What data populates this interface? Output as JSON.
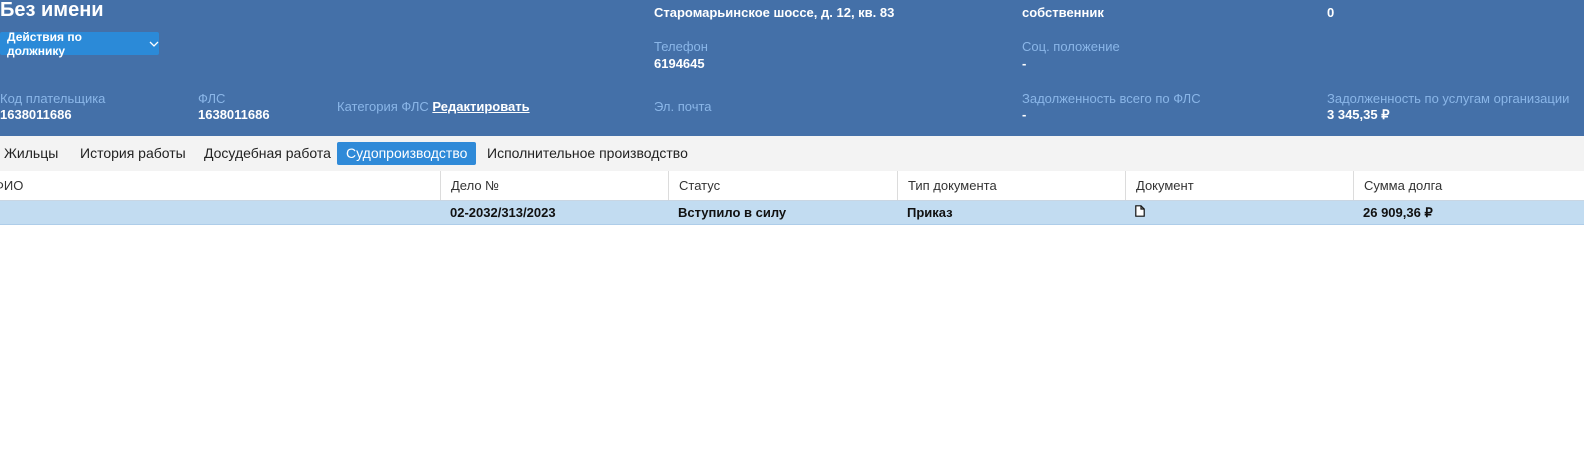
{
  "header": {
    "title": "Без имени",
    "actions_button": "Действия по должнику",
    "address_value": "Старомарьинское шоссе, д. 12, кв. 83",
    "ownership_value": "собственник",
    "top_right_value": "0",
    "phone": {
      "label": "Телефон",
      "value": "6194645"
    },
    "social": {
      "label": "Соц. положение",
      "value": "-"
    },
    "payer_code": {
      "label": "Код плательщика",
      "value": "1638011686"
    },
    "fls": {
      "label": "ФЛС",
      "value": "1638011686"
    },
    "fls_category": {
      "label": "Категория ФЛС",
      "link": "Редактировать"
    },
    "email": {
      "label": "Эл. почта"
    },
    "debt_total": {
      "label": "Задолженность всего по ФЛС",
      "value": "-"
    },
    "debt_org": {
      "label": "Задолженность по услугам организации",
      "value": "3 345,35 ₽"
    }
  },
  "tabs": [
    {
      "label": "Жильцы",
      "active": false
    },
    {
      "label": "История работы",
      "active": false
    },
    {
      "label": "Досудебная работа",
      "active": false
    },
    {
      "label": "Судопроизводство",
      "active": true
    },
    {
      "label": "Исполнительное производство",
      "active": false
    }
  ],
  "table": {
    "columns": [
      "ФИО",
      "Дело №",
      "Статус",
      "Тип документа",
      "Документ",
      "Сумма долга"
    ],
    "rows": [
      {
        "fio": "",
        "case_no": "02-2032/313/2023",
        "status": "Вступило в силу",
        "doc_type": "Приказ",
        "document_icon": "document-icon",
        "debt": "26 909,36 ₽"
      }
    ]
  },
  "colors": {
    "header_bg": "#4470a8",
    "label_color": "#8ab6e8",
    "accent": "#2f8ad8",
    "selected_row": "#c2dcf1"
  }
}
